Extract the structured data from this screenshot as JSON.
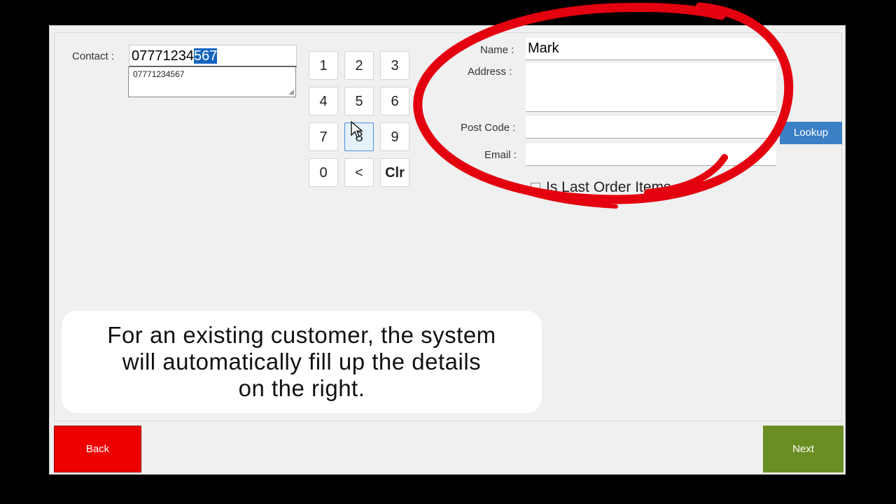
{
  "contact": {
    "label": "Contact :",
    "value_plain": "0777123",
    "value_mid": "4",
    "value_selected": "567",
    "suggestion": "07771234567",
    "grip": "◢"
  },
  "keypad": [
    "1",
    "2",
    "3",
    "4",
    "5",
    "6",
    "7",
    "8",
    "9",
    "0",
    "<",
    "Clr"
  ],
  "details": {
    "name_label": "Name :",
    "name_value": "Mark",
    "address_label": "Address :",
    "postcode_label": "Post Code :",
    "email_label": "Email :",
    "lookup_label": "Lookup",
    "last_order_label": "Is Last Order Items"
  },
  "caption": {
    "line1": "For an existing customer, the system",
    "line2": "will automatically fill up the details",
    "line3": "on the right."
  },
  "buttons": {
    "back": "Back",
    "next": "Next"
  },
  "colors": {
    "annotation_circle": "#e3000f",
    "back": "#ee0000",
    "next": "#6b8e23",
    "lookup": "#3b80c5",
    "selection": "#1565c0"
  },
  "icons": {
    "cursor": "mouse-pointer-icon",
    "annotation": "red-circle-annotation"
  }
}
